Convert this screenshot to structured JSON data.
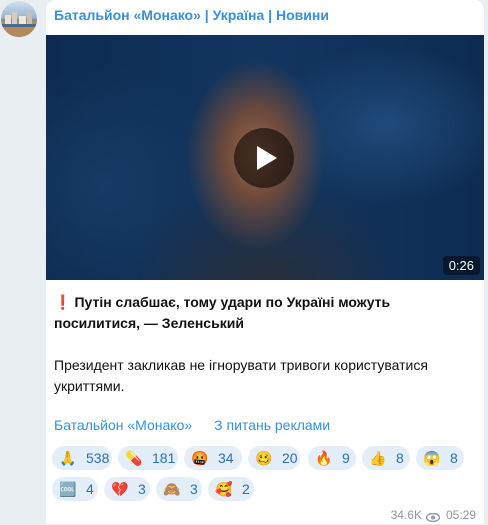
{
  "channel": {
    "name": "Батальйон «Монако» | Україна | Новини"
  },
  "video": {
    "duration": "0:26"
  },
  "post": {
    "title_emoji": "❗",
    "title": "Путін слабшає, тому удари по Україні можуть посилитися, — Зеленський",
    "body": "Президент закликав не ігнорувати тривоги користуватися укриттями."
  },
  "links": [
    "Батальйон «Монако»",
    "З питань реклами"
  ],
  "reactions": [
    {
      "emoji": "🙏",
      "count": "538",
      "icon": "pray-icon"
    },
    {
      "emoji": "💊",
      "count": "181",
      "icon": "pill-icon"
    },
    {
      "emoji": "🤬",
      "count": "34",
      "icon": "cursing-face-icon"
    },
    {
      "emoji": "🥴",
      "count": "20",
      "icon": "woozy-face-icon"
    },
    {
      "emoji": "🔥",
      "count": "9",
      "icon": "fire-icon"
    },
    {
      "emoji": "👍",
      "count": "8",
      "icon": "thumbs-up-icon"
    },
    {
      "emoji": "😱",
      "count": "8",
      "icon": "screaming-face-icon"
    },
    {
      "emoji": "🆒",
      "count": "4",
      "icon": "cool-icon"
    },
    {
      "emoji": "💔",
      "count": "3",
      "icon": "broken-heart-icon"
    },
    {
      "emoji": "🙈",
      "count": "3",
      "icon": "see-no-evil-icon"
    },
    {
      "emoji": "🥰",
      "count": "2",
      "icon": "smiling-hearts-icon"
    }
  ],
  "meta": {
    "views": "34.6K",
    "time": "05:29"
  },
  "colors": {
    "accent": "#3a8fd6",
    "reaction_bg": "#e3eef9",
    "background": "#e9eef2"
  }
}
